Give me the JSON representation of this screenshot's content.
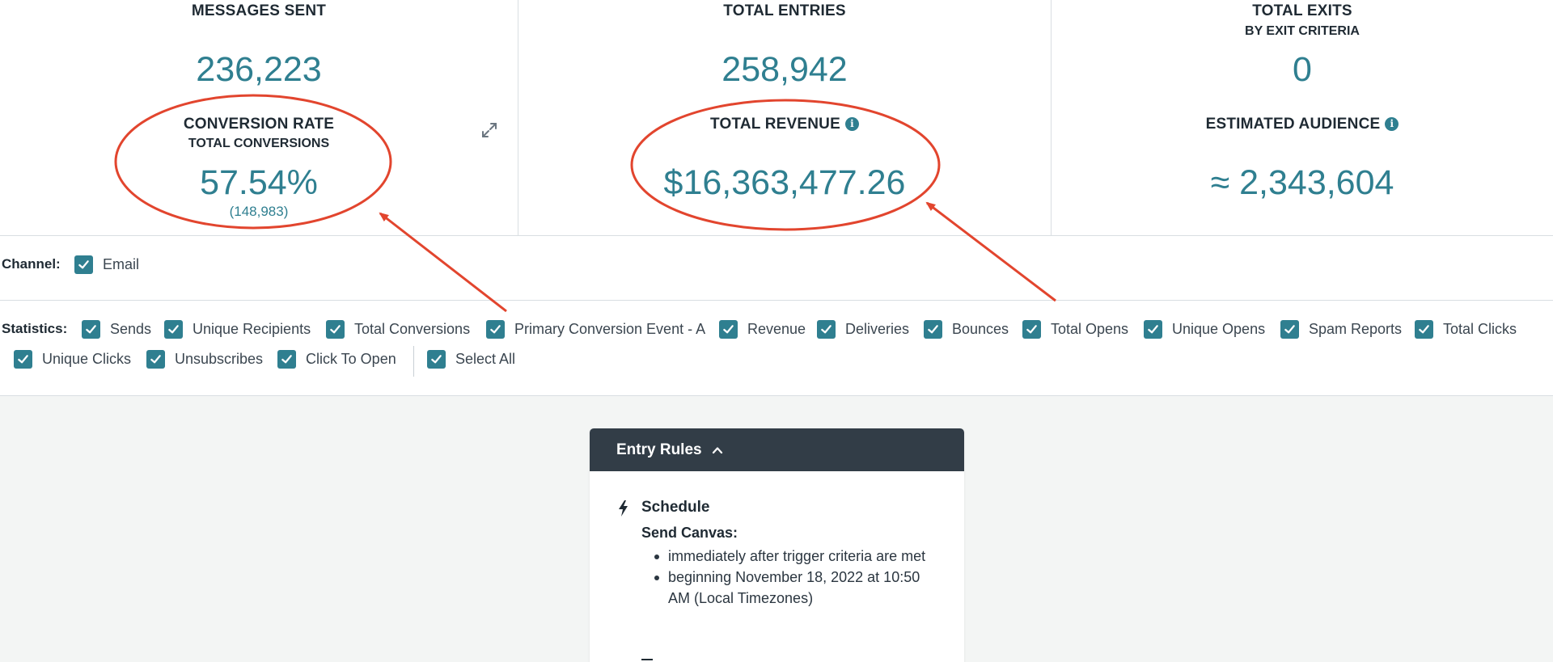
{
  "stats": {
    "messages_sent": {
      "label": "MESSAGES SENT",
      "value": "236,223"
    },
    "conversion": {
      "label": "CONVERSION RATE",
      "sublabel": "TOTAL CONVERSIONS",
      "value": "57.54%",
      "count": "(148,983)"
    },
    "total_entries": {
      "label": "TOTAL ENTRIES",
      "value": "258,942"
    },
    "total_revenue": {
      "label": "TOTAL REVENUE",
      "value": "$16,363,477.26"
    },
    "total_exits": {
      "label": "TOTAL EXITS",
      "sublabel": "BY EXIT CRITERIA",
      "value": "0"
    },
    "estimated_audience": {
      "label": "ESTIMATED AUDIENCE",
      "value": "≈ 2,343,604"
    }
  },
  "channel": {
    "label": "Channel:",
    "options": [
      {
        "label": "Email",
        "checked": true
      }
    ]
  },
  "statistics": {
    "label": "Statistics:",
    "options": [
      {
        "label": "Sends",
        "checked": true
      },
      {
        "label": "Unique Recipients",
        "checked": true
      },
      {
        "label": "Total Conversions",
        "checked": true
      },
      {
        "label": "Primary Conversion Event - A",
        "checked": true
      },
      {
        "label": "Revenue",
        "checked": true
      },
      {
        "label": "Deliveries",
        "checked": true
      },
      {
        "label": "Bounces",
        "checked": true
      },
      {
        "label": "Total Opens",
        "checked": true
      },
      {
        "label": "Unique Opens",
        "checked": true
      },
      {
        "label": "Spam Reports",
        "checked": true
      },
      {
        "label": "Total Clicks",
        "checked": true
      },
      {
        "label": "Unique Clicks",
        "checked": true
      },
      {
        "label": "Unsubscribes",
        "checked": true
      },
      {
        "label": "Click To Open",
        "checked": true
      },
      {
        "label": "Select All",
        "checked": true
      }
    ]
  },
  "entry_rules": {
    "title": "Entry Rules",
    "schedule_title": "Schedule",
    "send_label": "Send Canvas:",
    "bullets": [
      "immediately after trigger criteria are met",
      "beginning November 18, 2022 at 10:50 AM (Local Timezones)"
    ]
  },
  "icons": {
    "info": "info-icon",
    "expand": "expand-icon",
    "checkbox": "check-icon",
    "chevron": "chevron-up-icon",
    "schedule": "lightning-icon"
  },
  "colors": {
    "accent": "#2f7f90",
    "header_dark": "#323d47",
    "annotation": "#e2452e",
    "canvas_bg": "#f3f5f4"
  }
}
